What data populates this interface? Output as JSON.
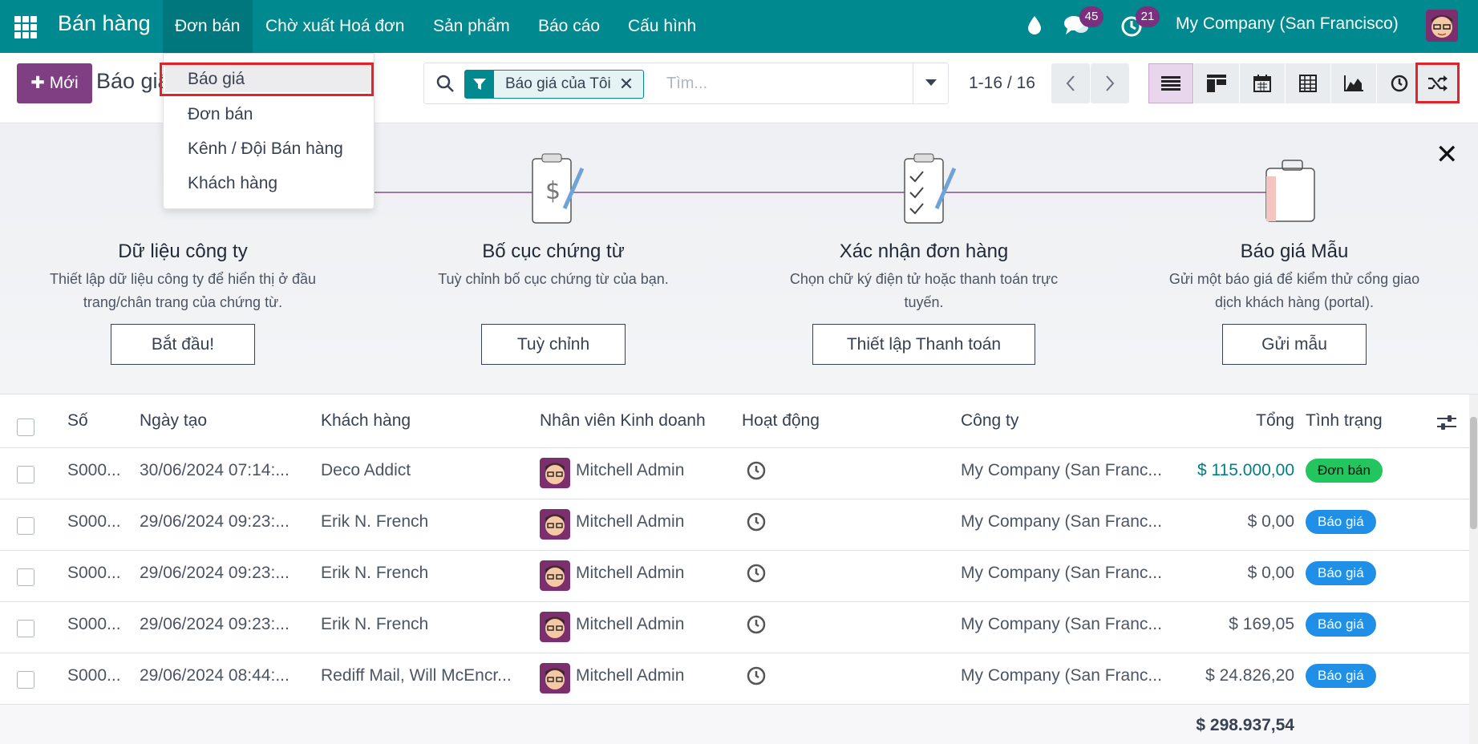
{
  "navbar": {
    "app_title": "Bán hàng",
    "menus": [
      "Đơn bán",
      "Chờ xuất Hoá đơn",
      "Sản phẩm",
      "Báo cáo",
      "Cấu hình"
    ],
    "messages_count": "45",
    "activities_count": "21",
    "company": "My Company (San Francisco)"
  },
  "control_panel": {
    "new_button": "Mới",
    "title": "Báo giá",
    "facet": "Báo giá của Tôi",
    "search_placeholder": "Tìm...",
    "pager": "1-16 / 16"
  },
  "dropdown": {
    "items": [
      "Báo giá",
      "Đơn bán",
      "Kênh / Đội Bán hàng",
      "Khách hàng"
    ]
  },
  "onboarding": {
    "steps": [
      {
        "title": "Dữ liệu công ty",
        "desc1": "Thiết lập dữ liệu công ty để hiển thị ở đầu",
        "desc2": "trang/chân trang của chứng từ.",
        "button": "Bắt đầu!"
      },
      {
        "title": "Bố cục chứng từ",
        "desc1": "Tuỳ chỉnh bố cục chứng từ của bạn.",
        "desc2": "",
        "button": "Tuỳ chỉnh"
      },
      {
        "title": "Xác nhận đơn hàng",
        "desc1": "Chọn chữ ký điện tử hoặc thanh toán trực",
        "desc2": "tuyến.",
        "button": "Thiết lập Thanh toán"
      },
      {
        "title": "Báo giá Mẫu",
        "desc1": "Gửi một báo giá để kiểm thử cổng giao",
        "desc2": "dịch khách hàng (portal).",
        "button": "Gửi mẫu"
      }
    ]
  },
  "table": {
    "headers": {
      "number": "Số",
      "date": "Ngày tạo",
      "customer": "Khách hàng",
      "salesperson": "Nhân viên Kinh doanh",
      "activity": "Hoạt động",
      "company": "Công ty",
      "total": "Tổng",
      "status": "Tình trạng"
    },
    "rows": [
      {
        "number": "S000...",
        "date": "30/06/2024 07:14:...",
        "customer": "Deco Addict",
        "salesperson": "Mitchell Admin",
        "company": "My Company (San Franc...",
        "total": "$ 115.000,00",
        "status": "Đơn bán"
      },
      {
        "number": "S000...",
        "date": "29/06/2024 09:23:...",
        "customer": "Erik N. French",
        "salesperson": "Mitchell Admin",
        "company": "My Company (San Franc...",
        "total": "$ 0,00",
        "status": "Báo giá"
      },
      {
        "number": "S000...",
        "date": "29/06/2024 09:23:...",
        "customer": "Erik N. French",
        "salesperson": "Mitchell Admin",
        "company": "My Company (San Franc...",
        "total": "$ 0,00",
        "status": "Báo giá"
      },
      {
        "number": "S000...",
        "date": "29/06/2024 09:23:...",
        "customer": "Erik N. French",
        "salesperson": "Mitchell Admin",
        "company": "My Company (San Franc...",
        "total": "$ 169,05",
        "status": "Báo giá"
      },
      {
        "number": "S000...",
        "date": "29/06/2024 08:44:...",
        "customer": "Rediff Mail, Will McEncr...",
        "salesperson": "Mitchell Admin",
        "company": "My Company (San Franc...",
        "total": "$ 24.826,20",
        "status": "Báo giá"
      }
    ],
    "grand_total": "$ 298.937,54"
  },
  "colors": {
    "brand": "#00898f",
    "primary": "#7f3f82",
    "sale_badge": "#22c55e",
    "quote_badge": "#1f8fe8",
    "highlight": "#e0242a"
  }
}
